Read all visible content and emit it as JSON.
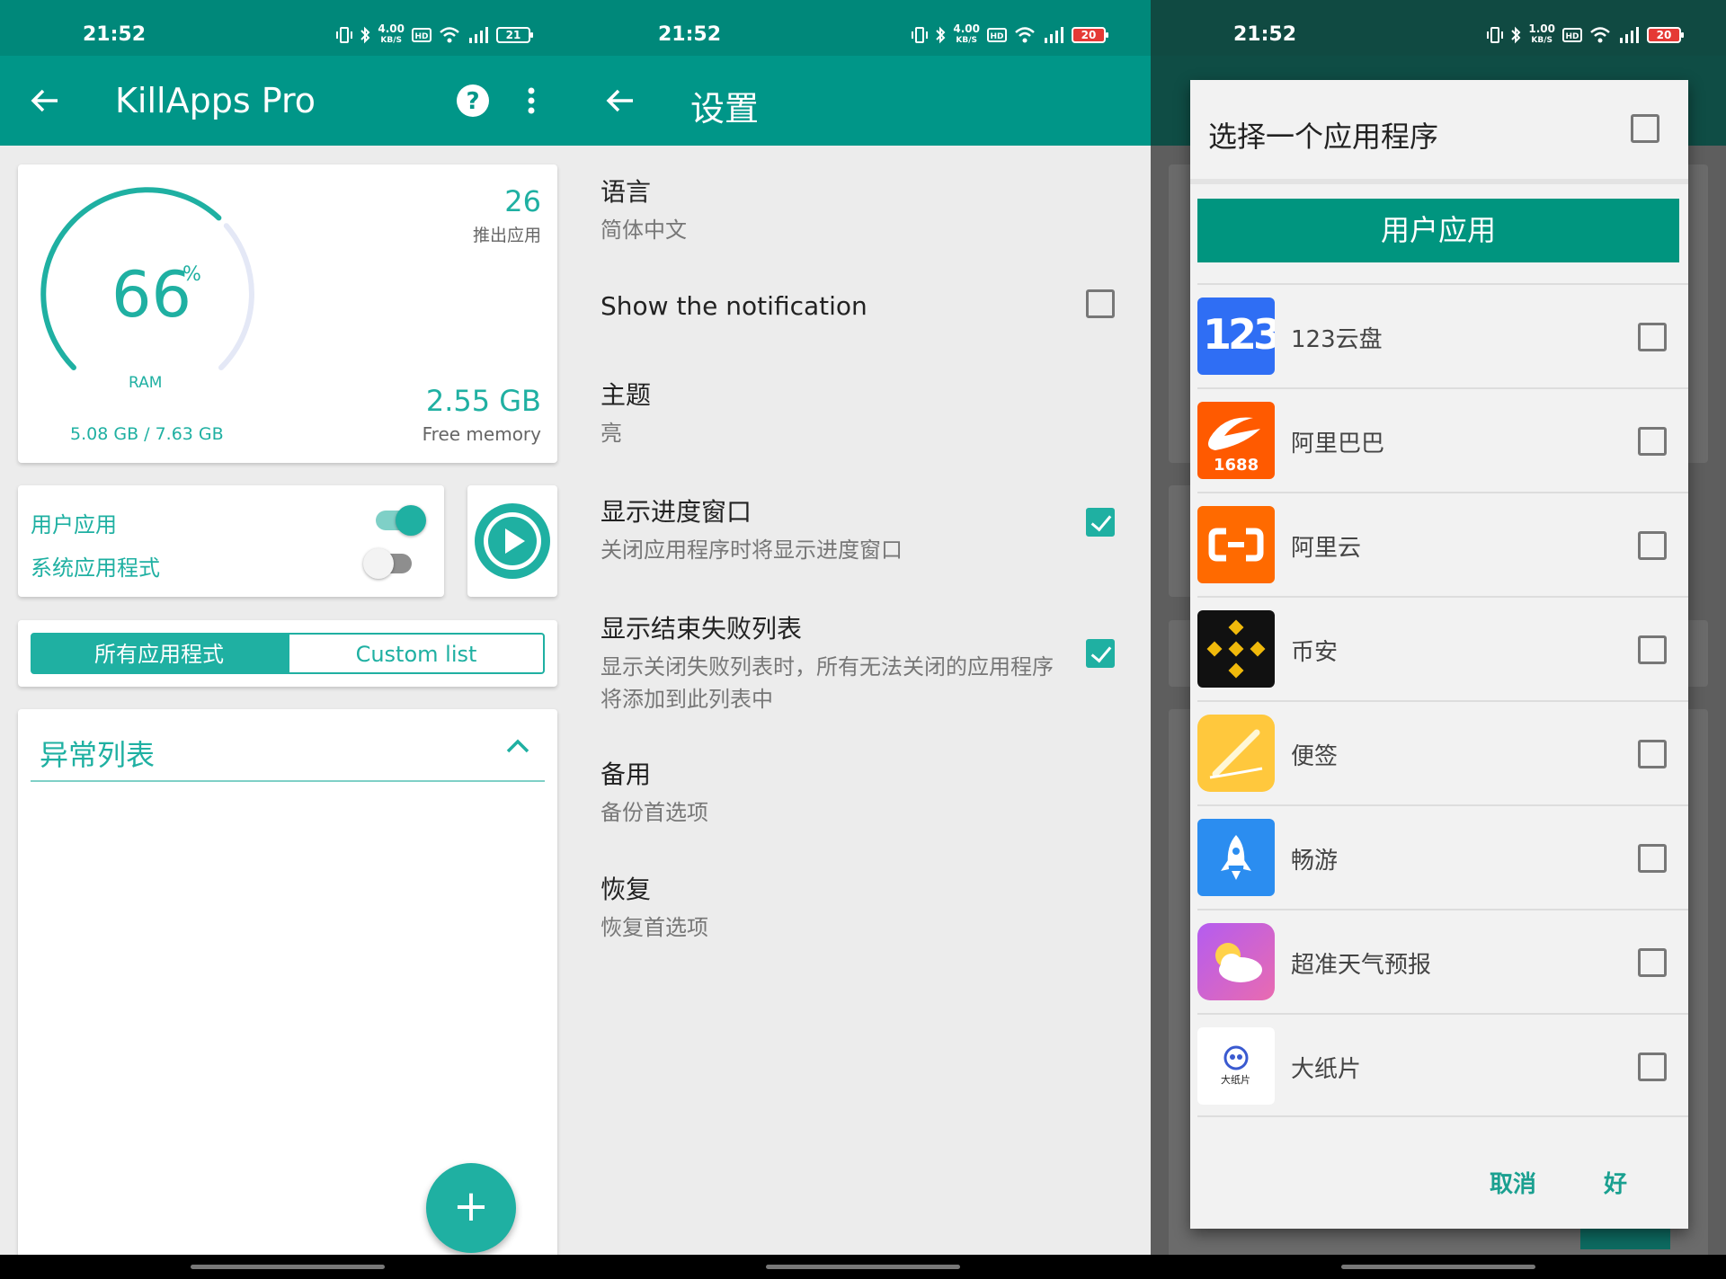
{
  "panel_main": {
    "status": {
      "time": "21:52",
      "net_speed": "4.00",
      "net_unit": "KB/S",
      "battery": "21"
    },
    "appbar": {
      "title": "KillApps Pro"
    },
    "ram": {
      "percent": "66",
      "percent_sign": "%",
      "label": "RAM",
      "used_total": "5.08 GB / 7.63 GB",
      "level": 0.66
    },
    "killed": {
      "count": "26",
      "label": "推出应用"
    },
    "free": {
      "value": "2.55 GB",
      "label": "Free memory"
    },
    "toggles": {
      "user_label": "用户应用",
      "user_on": true,
      "system_label": "系统应用程式",
      "system_on": false
    },
    "segments": {
      "all": "所有应用程式",
      "custom": "Custom list",
      "selected": "all"
    },
    "anomaly": {
      "title": "异常列表"
    },
    "fab_label": "+"
  },
  "panel_settings": {
    "status": {
      "time": "21:52",
      "net_speed": "4.00",
      "net_unit": "KB/S",
      "battery": "20"
    },
    "appbar": {
      "title": "设置"
    },
    "items": [
      {
        "title": "语言",
        "subtitle": "简体中文"
      },
      {
        "title": "Show the notification",
        "checked": false
      },
      {
        "title": "主题",
        "subtitle": "亮"
      },
      {
        "title": "显示进度窗口",
        "subtitle": "关闭应用程序时将显示进度窗口",
        "checked": true
      },
      {
        "title": "显示结束失败列表",
        "subtitle": "显示关闭失败列表时，所有无法关闭的应用程序将添加到此列表中",
        "checked": true
      },
      {
        "title": "备用",
        "subtitle": "备份首选项"
      },
      {
        "title": "恢复",
        "subtitle": "恢复首选项"
      }
    ]
  },
  "panel_dialog": {
    "status": {
      "time": "21:52",
      "net_speed": "1.00",
      "net_unit": "KB/S",
      "battery": "20"
    },
    "dialog": {
      "title": "选择一个应用程序",
      "tab": "用户应用",
      "apps": [
        {
          "name": "123云盘",
          "icon": "123-cloud-icon",
          "icon_text": "123"
        },
        {
          "name": "阿里巴巴",
          "icon": "alibaba-icon",
          "icon_text": "1688"
        },
        {
          "name": "阿里云",
          "icon": "aliyun-icon",
          "icon_text": "(-)"
        },
        {
          "name": "币安",
          "icon": "binance-icon",
          "icon_text": ""
        },
        {
          "name": "便签",
          "icon": "notes-icon",
          "icon_text": ""
        },
        {
          "name": "畅游",
          "icon": "rocket-icon",
          "icon_text": ""
        },
        {
          "name": "超准天气预报",
          "icon": "weather-icon",
          "icon_text": ""
        },
        {
          "name": "大纸片",
          "icon": "dazhipian-icon",
          "icon_text": "大纸片"
        }
      ],
      "cancel": "取消",
      "ok": "好"
    }
  },
  "colors": {
    "primary": "#009688",
    "accent": "#1fb0a2",
    "statusbar": "#00887a"
  }
}
